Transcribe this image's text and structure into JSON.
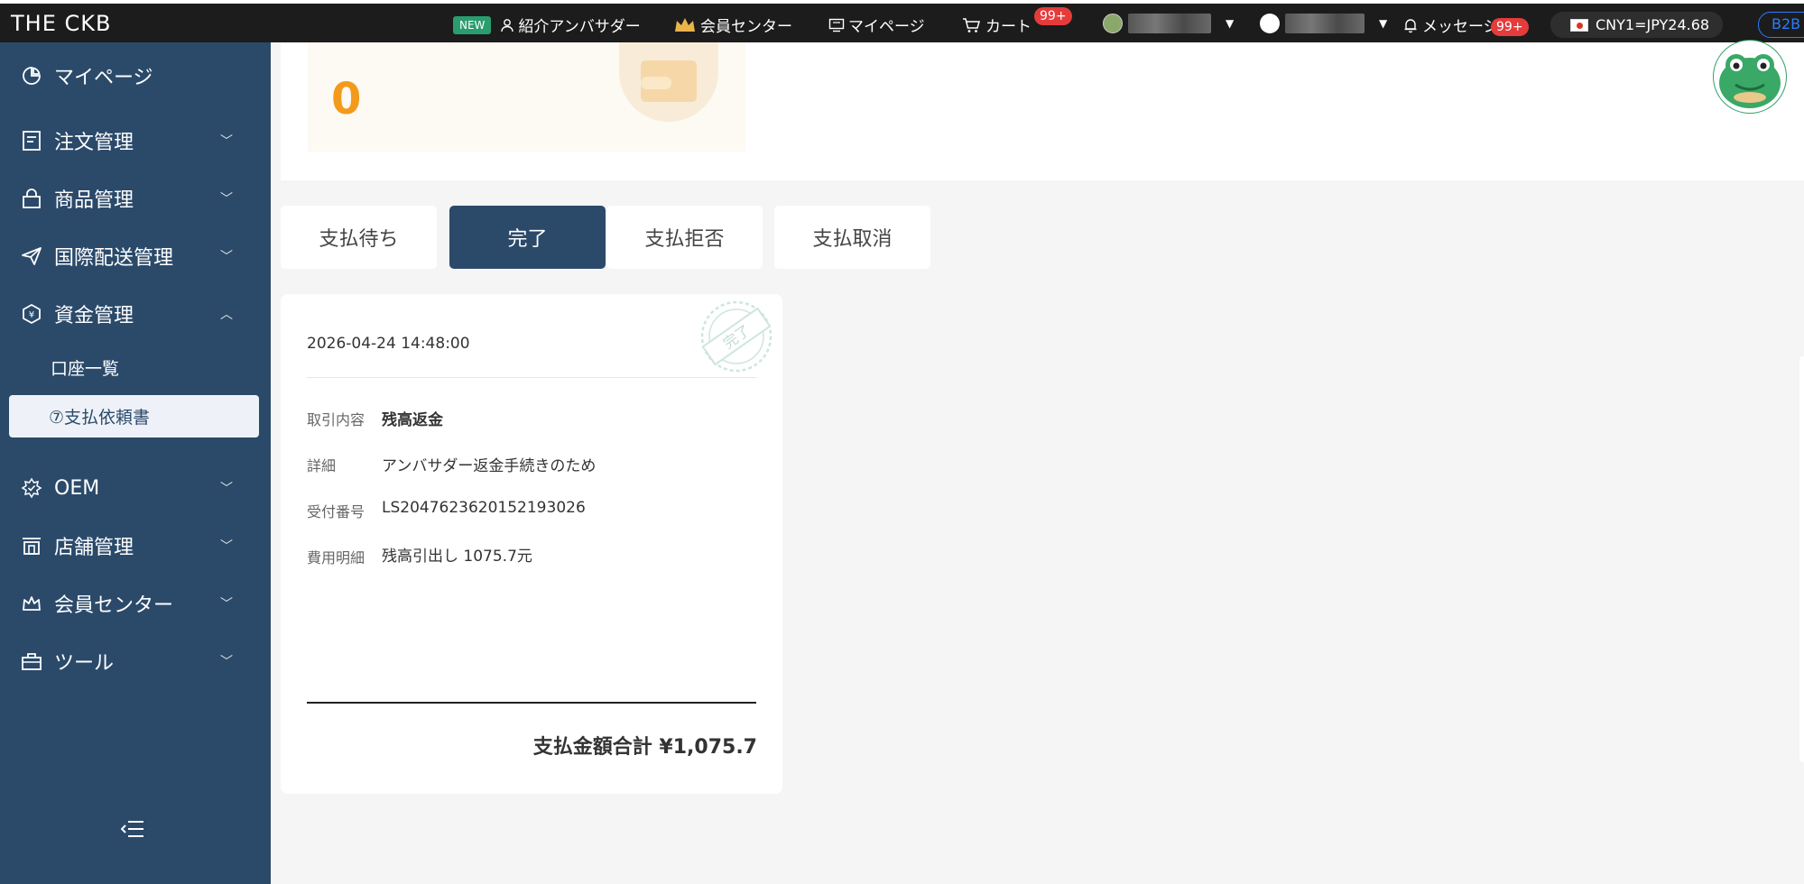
{
  "topbar": {
    "logo": "THE CKB",
    "new_badge": "NEW",
    "ambassador": "紹介アンバサダー",
    "member_center": "会員センター",
    "mypage": "マイページ",
    "cart": "カート",
    "cart_count": "99+",
    "messages": "メッセージ",
    "messages_count": "99+",
    "rate": "CNY1=JPY24.68",
    "b2b": "B2B"
  },
  "sidebar": {
    "items": [
      {
        "label": "マイページ",
        "icon": "dashboard-icon"
      },
      {
        "label": "注文管理",
        "icon": "order-icon"
      },
      {
        "label": "商品管理",
        "icon": "bag-icon"
      },
      {
        "label": "国際配送管理",
        "icon": "send-icon"
      },
      {
        "label": "資金管理",
        "icon": "money-icon"
      },
      {
        "label": "OEM",
        "icon": "oem-icon"
      },
      {
        "label": "店舗管理",
        "icon": "store-icon"
      },
      {
        "label": "会員センター",
        "icon": "crown-icon"
      },
      {
        "label": "ツール",
        "icon": "toolbox-icon"
      }
    ],
    "sub_items": [
      {
        "label": "口座一覧"
      },
      {
        "label": "⑦支払依頼書"
      }
    ]
  },
  "summary": {
    "value": "0"
  },
  "tabs": [
    {
      "label": "支払待ち",
      "active": false
    },
    {
      "label": "完了",
      "active": true
    },
    {
      "label": "支払拒否",
      "active": false
    },
    {
      "label": "支払取消",
      "active": false
    }
  ],
  "card": {
    "date": "2026-04-24 14:48:00",
    "rows": [
      {
        "label": "取引内容",
        "value": "残高返金"
      },
      {
        "label": "詳細",
        "value": "アンバサダー返金手続きのため"
      },
      {
        "label": "受付番号",
        "value": "LS2047623620152193026"
      },
      {
        "label": "費用明細",
        "value": "残高引出し 1075.7元"
      }
    ],
    "total": "支払金額合計 ¥1,075.7",
    "stamp_text": "完了"
  },
  "colors": {
    "sidebar": "#2b4a6a",
    "accent_orange": "#f39a1c",
    "badge_red": "#e63b3b"
  }
}
